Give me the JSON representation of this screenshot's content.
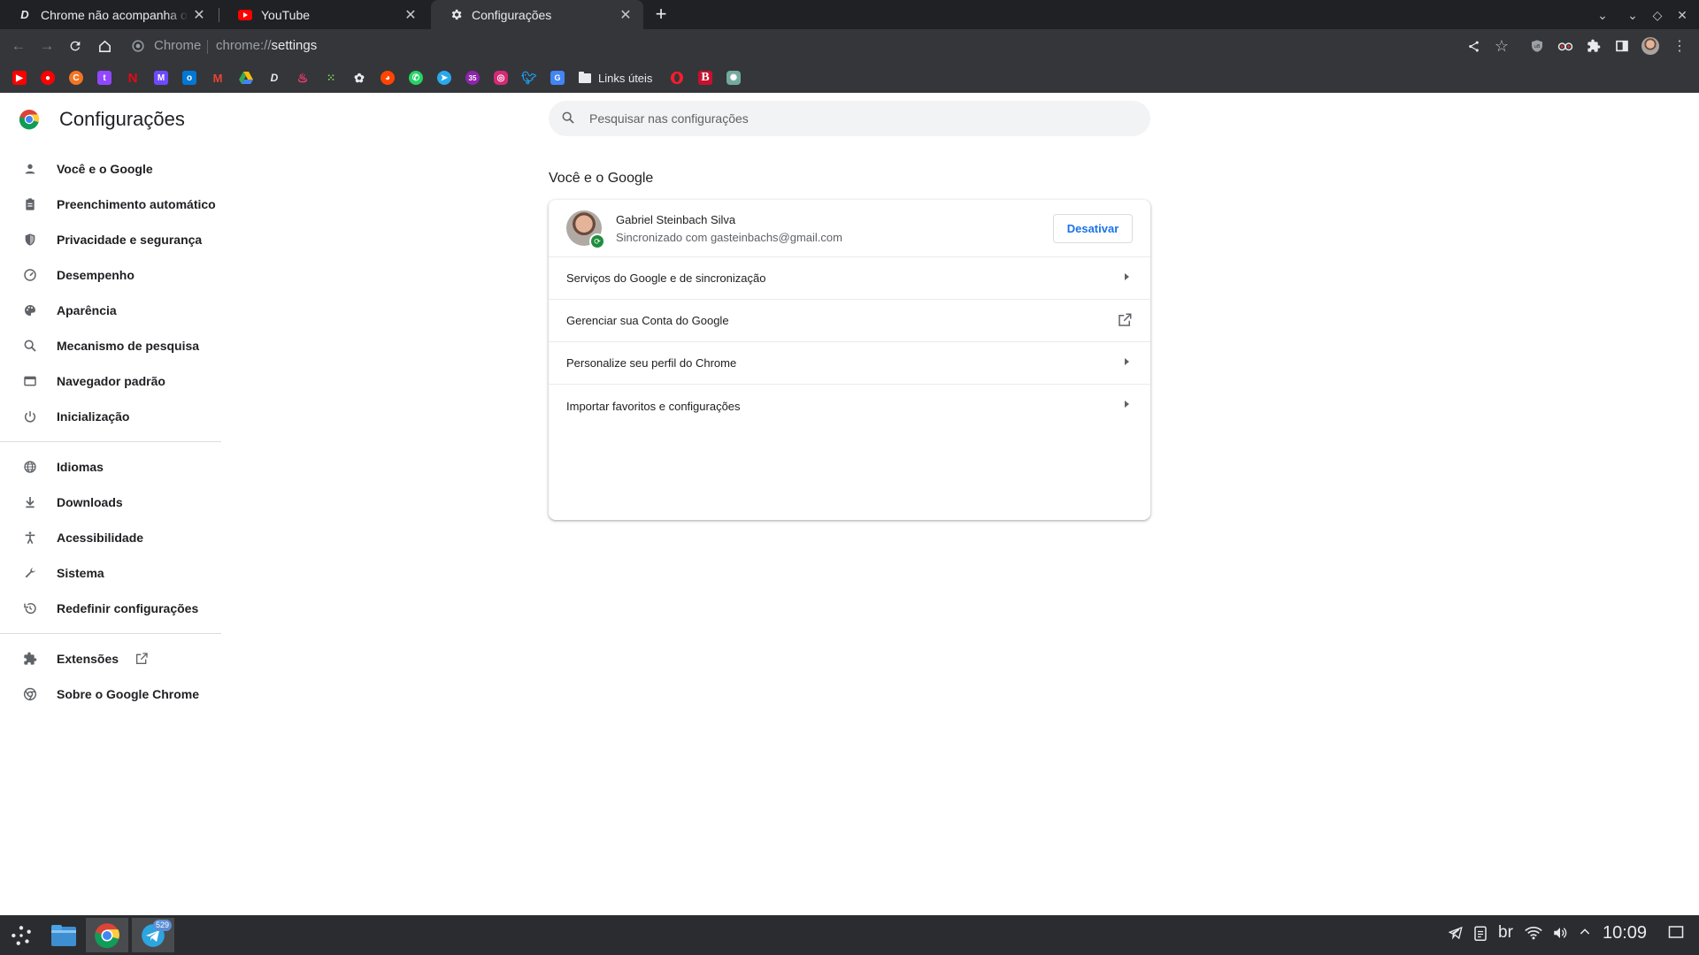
{
  "tabs": [
    {
      "title": "Chrome não acompanha o te",
      "favicon": "d-favicon",
      "active": false
    },
    {
      "title": "YouTube",
      "favicon": "youtube-icon",
      "active": false
    },
    {
      "title": "Configurações",
      "favicon": "gear-icon",
      "active": true
    }
  ],
  "omnibox": {
    "scheme_label": "Chrome",
    "url_prefix": "chrome://",
    "url_path": "settings"
  },
  "bookmarks": {
    "folder_label": "Links úteis",
    "icons": [
      "youtube",
      "youtube-music",
      "crunchyroll",
      "twitch",
      "netflix",
      "proton-mail",
      "outlook",
      "gmail",
      "google-drive",
      "d-app",
      "tinder",
      "pixel-app",
      "lifehacker",
      "reddit",
      "whatsapp",
      "telegram",
      "calendar",
      "instagram",
      "twitter",
      "translate"
    ],
    "after_folder": [
      "opera",
      "b-app",
      "chatgpt"
    ]
  },
  "settings": {
    "app_title": "Configurações",
    "search_placeholder": "Pesquisar nas configurações",
    "nav_group1": [
      {
        "label": "Você e o Google",
        "icon": "person-icon"
      },
      {
        "label": "Preenchimento automático",
        "icon": "clipboard-icon"
      },
      {
        "label": "Privacidade e segurança",
        "icon": "shield-icon"
      },
      {
        "label": "Desempenho",
        "icon": "speedometer-icon"
      },
      {
        "label": "Aparência",
        "icon": "palette-icon"
      },
      {
        "label": "Mecanismo de pesquisa",
        "icon": "search-icon"
      },
      {
        "label": "Navegador padrão",
        "icon": "browser-icon"
      },
      {
        "label": "Inicialização",
        "icon": "power-icon"
      }
    ],
    "nav_group2": [
      {
        "label": "Idiomas",
        "icon": "globe-icon"
      },
      {
        "label": "Downloads",
        "icon": "download-icon"
      },
      {
        "label": "Acessibilidade",
        "icon": "accessibility-icon"
      },
      {
        "label": "Sistema",
        "icon": "wrench-icon"
      },
      {
        "label": "Redefinir configurações",
        "icon": "restore-icon"
      }
    ],
    "nav_group3": [
      {
        "label": "Extensões",
        "icon": "puzzle-icon"
      },
      {
        "label": "Sobre o Google Chrome",
        "icon": "chrome-icon"
      }
    ],
    "section_title": "Você e o Google",
    "account": {
      "name": "Gabriel Steinbach Silva",
      "sync_text": "Sincronizado com gasteinbachs@gmail.com",
      "turn_off_label": "Desativar"
    },
    "rows": [
      {
        "label": "Serviços do Google e de sincronização",
        "kind": "arrow"
      },
      {
        "label": "Gerenciar sua Conta do Google",
        "kind": "external"
      },
      {
        "label": "Personalize seu perfil do Chrome",
        "kind": "arrow"
      },
      {
        "label": "Importar favoritos e configurações",
        "kind": "arrow"
      }
    ]
  },
  "taskbar": {
    "apps": [
      "launcher-icon",
      "files-icon",
      "chrome-icon",
      "telegram-icon"
    ],
    "telegram_badge": "529",
    "keyboard_layout": "br",
    "clock": "10:09"
  },
  "colors": {
    "accent": "#1a73e8",
    "sync_green": "#1e8e3e",
    "titlebar": "#202124",
    "toolbar": "#35363a"
  }
}
